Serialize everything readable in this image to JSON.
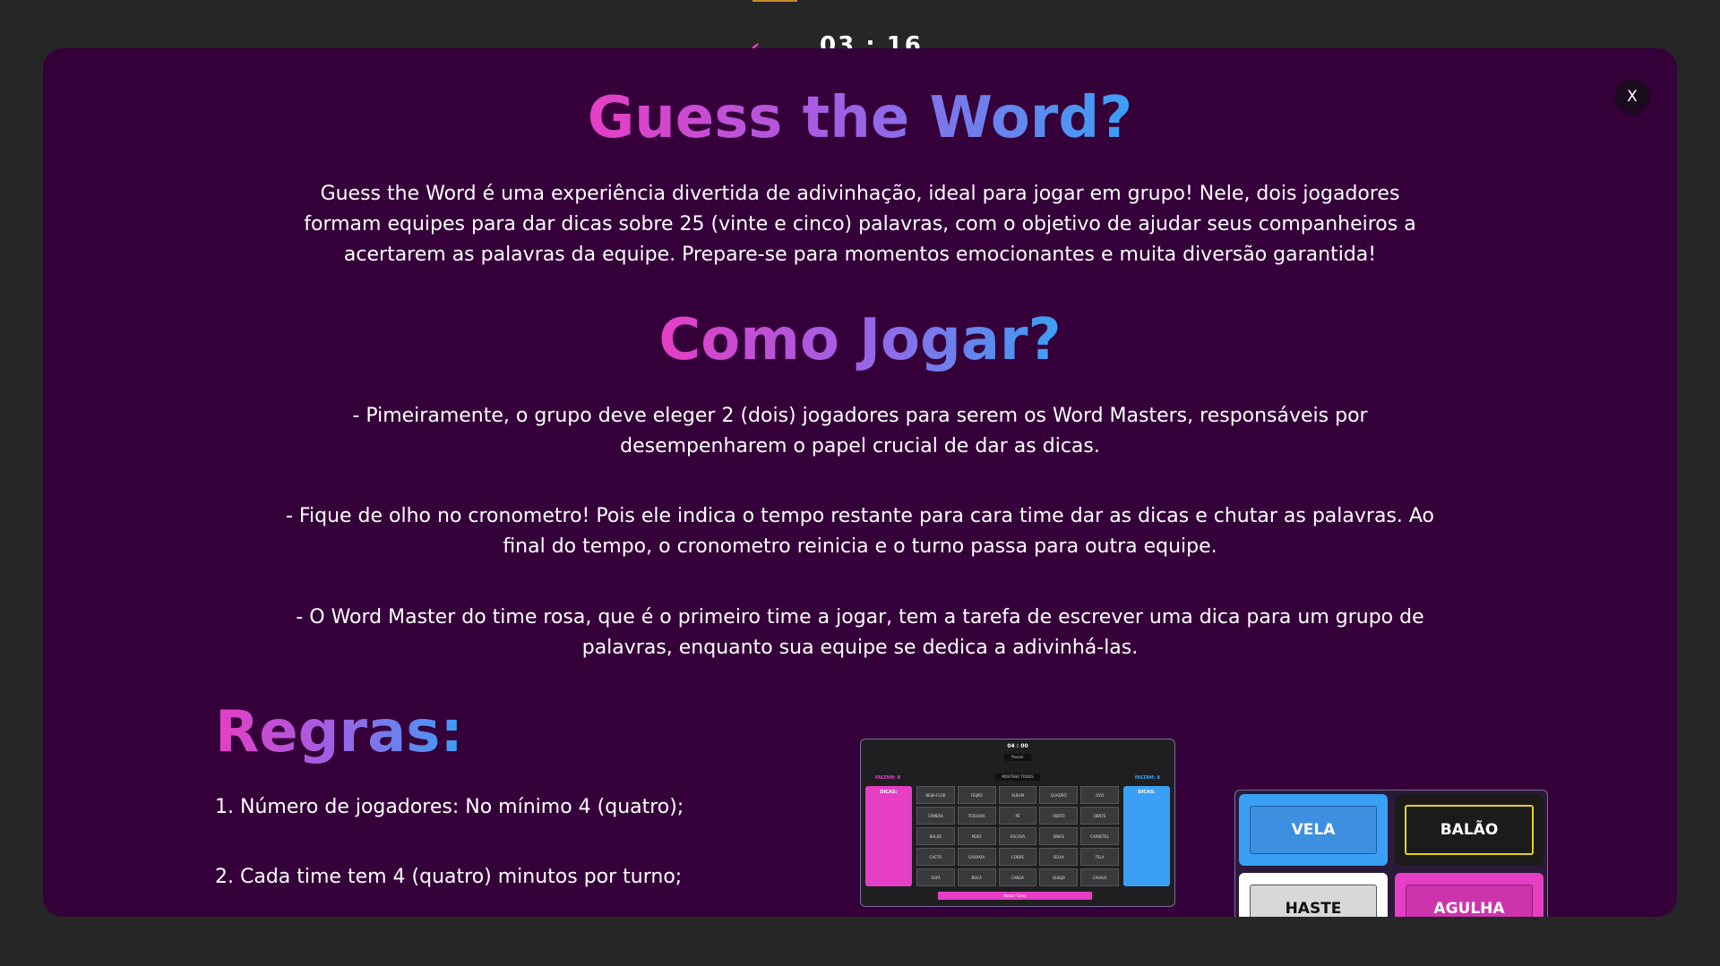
{
  "background": {
    "timer": "03 : 16",
    "back_arrow": "‹"
  },
  "modal": {
    "close_label": "X",
    "title": "Guess the Word?",
    "intro": "Guess the Word é uma experiência divertida de adivinhação, ideal para jogar em grupo! Nele, dois jogadores formam equipes para dar dicas sobre 25 (vinte e cinco) palavras, com o objetivo de ajudar seus companheiros a acertarem as palavras da equipe. Prepare-se para momentos emocionantes e muita diversão garantida!",
    "how_to_title": "Como Jogar?",
    "how_to": [
      "- Pimeiramente, o grupo deve eleger 2 (dois) jogadores para serem os Word Masters, responsáveis por desempenharem o papel crucial de dar as dicas.",
      "- Fique de olho no cronometro! Pois ele indica o tempo restante para cara time dar as dicas e chutar as palavras. Ao final do tempo, o cronometro reinicia e o turno passa para outra equipe.",
      "- O Word Master do time rosa, que é o primeiro time a jogar, tem a tarefa de escrever uma dica para um grupo de palavras, enquanto sua equipe se dedica a adivinhá-las."
    ],
    "rules_title": "Regras:",
    "rules": [
      "1. Número de jogadores: No mínimo 4 (quatro);",
      "2. Cada time tem 4 (quatro) minutos por turno;"
    ]
  },
  "preview_game": {
    "timer": "04 : 00",
    "pause": "Pausar",
    "show_all": "MOSTRAR TODOS",
    "left_remaining": "FALTAM: 8",
    "right_remaining": "FALTAM: 8",
    "left_hints": "DICAS:",
    "right_hints": "DICAS:",
    "pass_turn": "Passar Turno",
    "words": [
      "BEIJA-FLOR",
      "FEIJÃO",
      "ÁLBUM",
      "QUADRO",
      "OVO",
      "CÂMERA",
      "TESOURA",
      "PÉ",
      "VENTO",
      "DENTE",
      "BALDE",
      "PEÃO",
      "ESCOVA",
      "SINOS",
      "CARRETEL",
      "CACTO",
      "GARRAFA",
      "COBRE",
      "SELVA",
      "TELA",
      "SOFÁ",
      "BOCA",
      "CANOA",
      "QUEIJO",
      "CAVALO"
    ]
  },
  "preview_cards": [
    {
      "label": "VELA",
      "style": "blue"
    },
    {
      "label": "BALÃO",
      "style": "black"
    },
    {
      "label": "HASTE",
      "style": "white"
    },
    {
      "label": "AGULHA",
      "style": "pink"
    }
  ],
  "colors": {
    "modal_bg": "#35003a",
    "pink": "#e63ec4",
    "blue": "#3aa0f5",
    "page_bg": "#262626"
  }
}
